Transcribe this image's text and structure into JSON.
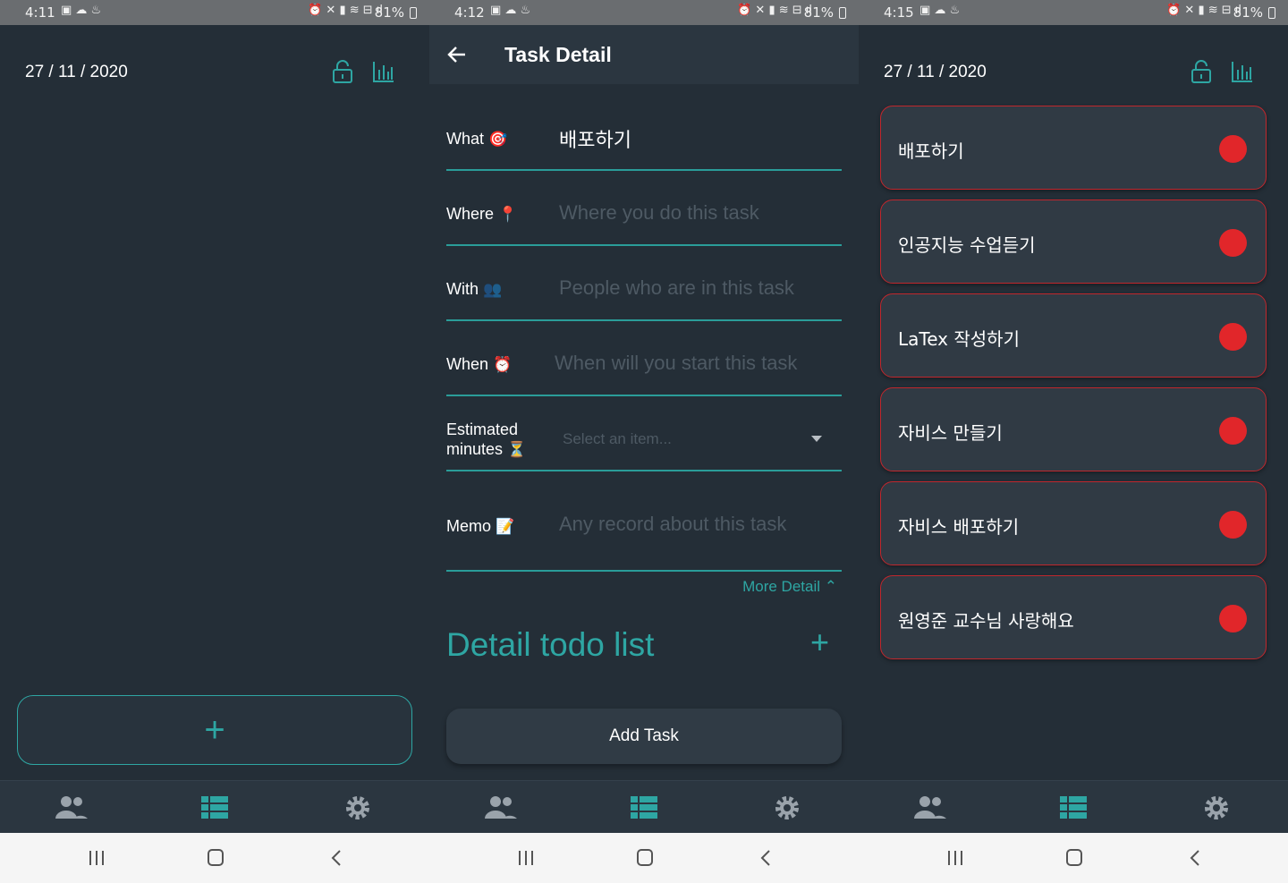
{
  "colors": {
    "accent": "#2ea6a3",
    "background": "#242e37",
    "priority_red": "#e1262a"
  },
  "screens": [
    {
      "status": {
        "time": "4:11",
        "battery": "81%"
      },
      "date": "27 / 11 / 2020",
      "icons": [
        "lock-open-icon",
        "bar-chart-icon"
      ],
      "add_label": "+"
    },
    {
      "status": {
        "time": "4:12",
        "battery": "81%"
      },
      "title": "Task Detail",
      "fields": {
        "what": {
          "label": "What",
          "emoji": "🎯",
          "value": "배포하기"
        },
        "where": {
          "label": "Where",
          "emoji": "📍",
          "placeholder": "Where you do this task"
        },
        "with": {
          "label": "With",
          "emoji": "👥",
          "placeholder": "People who are in this task"
        },
        "when": {
          "label": "When",
          "emoji": "⏰",
          "placeholder": "When will you start this task"
        },
        "estimated": {
          "label_line1": "Estimated",
          "label_line2": "minutes",
          "emoji": "⏳",
          "placeholder": "Select an item..."
        },
        "memo": {
          "label": "Memo",
          "emoji": "📝",
          "placeholder": "Any record about this task"
        }
      },
      "more_detail": "More Detail",
      "detail_title": "Detail todo list",
      "detail_plus": "+",
      "add_task": "Add Task"
    },
    {
      "status": {
        "time": "4:15",
        "battery": "81%"
      },
      "date": "27 / 11 / 2020",
      "tasks": [
        "배포하기",
        "인공지능 수업듣기",
        "LaTex 작성하기",
        "자비스 만들기",
        "자비스 배포하기",
        "원영준 교수님 사랑해요"
      ]
    }
  ],
  "bottom_nav": [
    "people-icon",
    "list-icon",
    "settings-icon"
  ]
}
